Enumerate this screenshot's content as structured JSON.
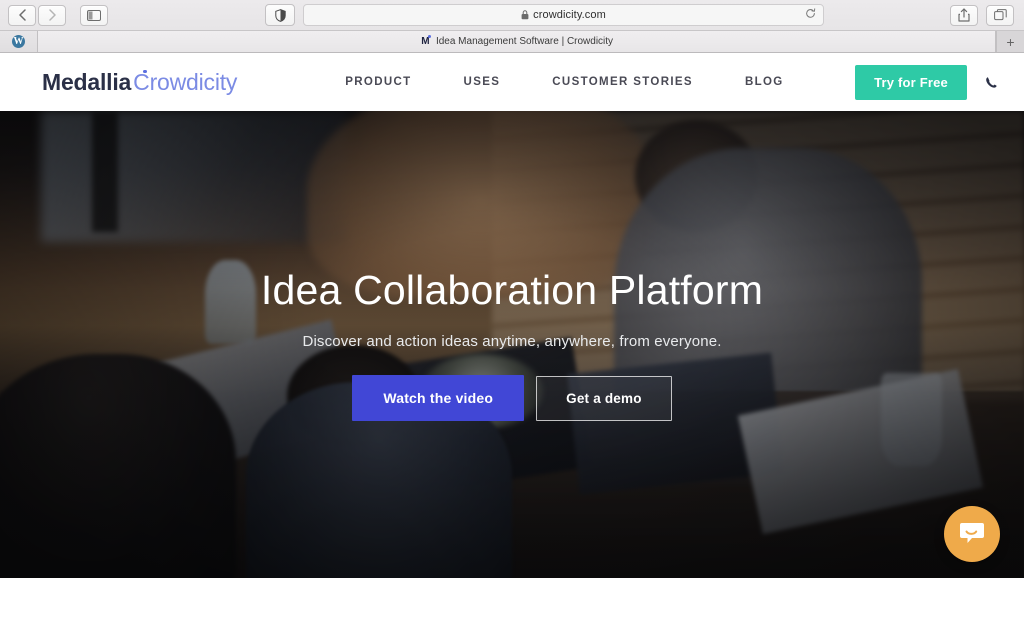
{
  "browser": {
    "back_icon": "back-chevron-icon",
    "forward_icon": "forward-chevron-icon",
    "sidebar_icon": "sidebar-toggle-icon",
    "shield_icon": "privacy-shield-icon",
    "url": "crowdicity.com",
    "lock_icon": "lock-icon",
    "reload_icon": "reload-icon",
    "share_icon": "share-icon",
    "tabs_overview_icon": "tabs-overview-icon",
    "new_tab_label": "+",
    "tabs": [
      {
        "title": "",
        "favicon": "wordpress-favicon",
        "favicon_letter": "W",
        "active": false
      },
      {
        "title": "Idea Management Software | Crowdicity",
        "favicon": "medallia-favicon",
        "favicon_letter": "M",
        "active": true
      }
    ]
  },
  "header": {
    "logo": {
      "brand": "Medallia",
      "product": "Crowdicity"
    },
    "nav": [
      {
        "label": "PRODUCT"
      },
      {
        "label": "USES"
      },
      {
        "label": "CUSTOMER STORIES"
      },
      {
        "label": "BLOG"
      }
    ],
    "cta_label": "Try for Free",
    "cta_color": "#2ecaa6",
    "phone_icon": "phone-icon"
  },
  "hero": {
    "title": "Idea Collaboration Platform",
    "subtitle": "Discover and action ideas anytime, anywhere, from everyone.",
    "primary_cta": "Watch the video",
    "primary_cta_color": "#4147d6",
    "secondary_cta": "Get a demo"
  },
  "chat": {
    "icon": "chat-bubble-icon",
    "color": "#efaa4a"
  }
}
